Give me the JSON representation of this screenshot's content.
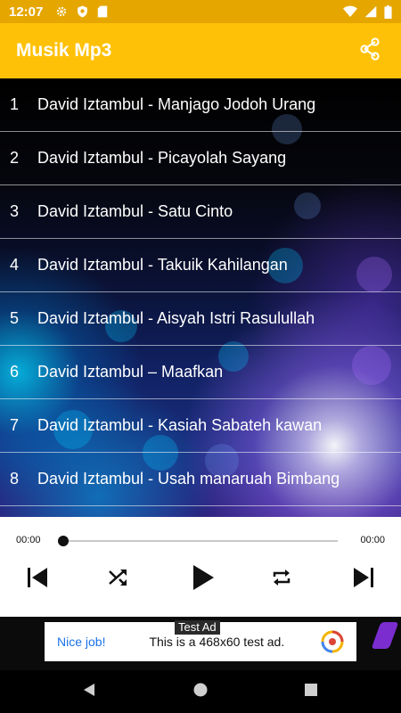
{
  "status_bar": {
    "time": "12:07",
    "left_icons": [
      "gear-icon",
      "shield-icon",
      "sd-card-icon"
    ],
    "right_icons": [
      "wifi-icon",
      "cell-signal-icon",
      "battery-icon"
    ]
  },
  "app_bar": {
    "title": "Musik Mp3",
    "share_icon": "share-icon"
  },
  "songs": [
    {
      "num": "1",
      "title": "David Iztambul - Manjago Jodoh Urang"
    },
    {
      "num": "2",
      "title": "David Iztambul - Picayolah Sayang"
    },
    {
      "num": "3",
      "title": "David Iztambul - Satu Cinto"
    },
    {
      "num": "4",
      "title": "David Iztambul - Takuik Kahilangan"
    },
    {
      "num": "5",
      "title": "David Iztambul - Aisyah Istri Rasulullah"
    },
    {
      "num": "6",
      "title": "David Iztambul – Maafkan"
    },
    {
      "num": "7",
      "title": "David Iztambul - Kasiah Sabateh kawan"
    },
    {
      "num": "8",
      "title": "David Iztambul - Usah manaruah Bimbang"
    }
  ],
  "player": {
    "current_time": "00:00",
    "total_time": "00:00",
    "progress": 0,
    "controls": [
      "skip-previous-icon",
      "shuffle-icon",
      "play-icon",
      "repeat-icon",
      "skip-next-icon"
    ]
  },
  "ad": {
    "label": "Test Ad",
    "nice_job": "Nice job!",
    "text": "This is a 468x60 test ad."
  },
  "nav_bar": {
    "buttons": [
      "back-icon",
      "home-icon",
      "recents-icon"
    ]
  },
  "colors": {
    "app_bar": "#ffc107",
    "status_bar": "#e6a600",
    "ad_link": "#1a73e8"
  }
}
